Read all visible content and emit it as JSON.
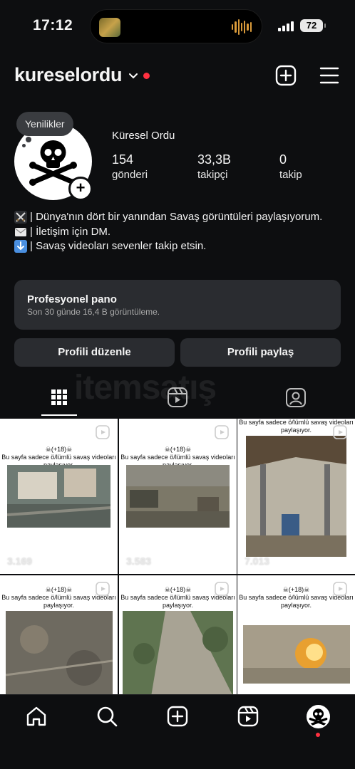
{
  "status_bar": {
    "time": "17:12",
    "battery": "72"
  },
  "header": {
    "username": "kureselordu"
  },
  "profile": {
    "notes_bubble": "Yenilikler",
    "display_name": "Küresel Ordu",
    "stats": [
      {
        "value": "154",
        "label": "gönderi"
      },
      {
        "value": "33,3B",
        "label": "takipçi"
      },
      {
        "value": "0",
        "label": "takip"
      }
    ],
    "bio": [
      {
        "icon": "crossed-swords-icon",
        "text": "| Dünya'nın dört bir yanından Savaş görüntüleri paylaşıyorum."
      },
      {
        "icon": "envelope-icon",
        "text": "| İletişim için DM."
      },
      {
        "icon": "down-arrow-icon",
        "text": "| Savaş videoları sevenler takip etsin."
      }
    ]
  },
  "dashboard": {
    "title": "Profesyonel pano",
    "subtitle": "Son 30 günde 16,4 B görüntüleme."
  },
  "buttons": {
    "edit": "Profili düzenle",
    "share": "Profili paylaş"
  },
  "watermark": "itemsatış",
  "posts": [
    {
      "caption_top": "☠(+18)☠",
      "caption": "Bu sayfa sadece ö/lümlü savaş videoları paylaşıyor.",
      "views": "3.169"
    },
    {
      "caption_top": "☠(+18)☠",
      "caption": "Bu sayfa sadece ö/lümlü savaş videoları paylaşıyor.",
      "views": "3.583"
    },
    {
      "caption_top": "",
      "caption": "Bu sayfa sadece ö/lümlü savaş videoları paylaşıyor.",
      "views": "7.013"
    },
    {
      "caption_top": "☠(+18)☠",
      "caption": "Bu sayfa sadece ö/lümlü savaş videoları paylaşıyor.",
      "views": ""
    },
    {
      "caption_top": "☠(+18)☠",
      "caption": "Bu sayfa sadece ö/lümlü savaş videoları paylaşıyor.",
      "views": ""
    },
    {
      "caption_top": "☠(+18)☠",
      "caption": "Bu sayfa sadece ö/lümlü savaş videoları paylaşıyor.",
      "views": ""
    }
  ],
  "colors": {
    "background": "#0d0e10",
    "card": "#2a2c30",
    "notification": "#ff3040"
  }
}
